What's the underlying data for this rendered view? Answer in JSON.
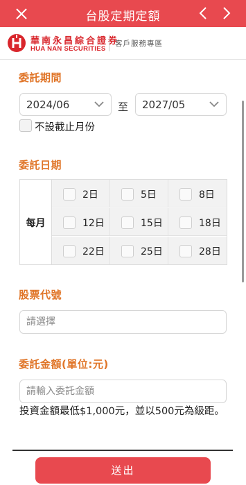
{
  "header": {
    "title": "台股定期定額",
    "close_icon": "close-icon",
    "prev_icon": "chevron-left-icon",
    "next_icon": "chevron-right-icon",
    "bar_color": "#e8494f"
  },
  "brand": {
    "name_zh": "華南永昌綜合證券",
    "name_en": "HUA NAN SECURITIES",
    "service_area": "客戶服務專區",
    "brand_color": "#d9262c"
  },
  "period": {
    "title": "委託期間",
    "start": "2024/06",
    "to": "至",
    "end": "2027/05",
    "no_end_label": "不設截止月份",
    "no_end_checked": false
  },
  "dates": {
    "title": "委託日期",
    "month_label": "每月",
    "days": [
      "2日",
      "5日",
      "8日",
      "12日",
      "15日",
      "18日",
      "22日",
      "25日",
      "28日"
    ]
  },
  "stock": {
    "title": "股票代號",
    "placeholder": "請選擇"
  },
  "amount": {
    "title": "委託金額(單位:元)",
    "placeholder": "請輸入委託金額",
    "note": "投資金額最低$1,000元，並以500元為級距。"
  },
  "submit_label": "送出",
  "accent_title_color": "#e07528"
}
